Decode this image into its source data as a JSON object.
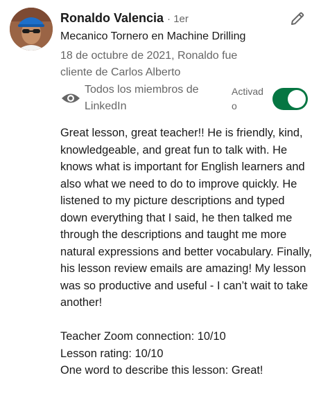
{
  "recommendation": {
    "author_name": "Ronaldo Valencia",
    "connection_degree": "· 1er",
    "headline": "Mecanico Tornero en Machine Drilling",
    "meta": "18 de octubre de 2021, Ronaldo fue cliente de Carlos Alberto",
    "visibility_icon": "eye-icon",
    "visibility_label": "Todos los miembros de LinkedIn",
    "toggle_label": "Activado",
    "toggle_on": true,
    "edit_icon": "pencil-icon",
    "body_paragraph": "Great lesson, great teacher!! He is friendly, kind, knowledgeable, and great fun to talk with. He knows what is important for English learners and also what we need to do to improve quickly. He listened to my picture descriptions and typed down everything that I said, he then talked me through the descriptions and taught me more natural expressions and better vocabulary. Finally, his lesson review emails are amazing! My lesson was so productive and useful - I can’t wait to take another!",
    "ratings": [
      "Teacher Zoom connection: 10/10",
      "Lesson rating: 10/10",
      "One word to describe this lesson: Great!"
    ]
  },
  "colors": {
    "toggle_on": "#057642",
    "secondary_text": "#666666",
    "primary_text": "#191919"
  }
}
